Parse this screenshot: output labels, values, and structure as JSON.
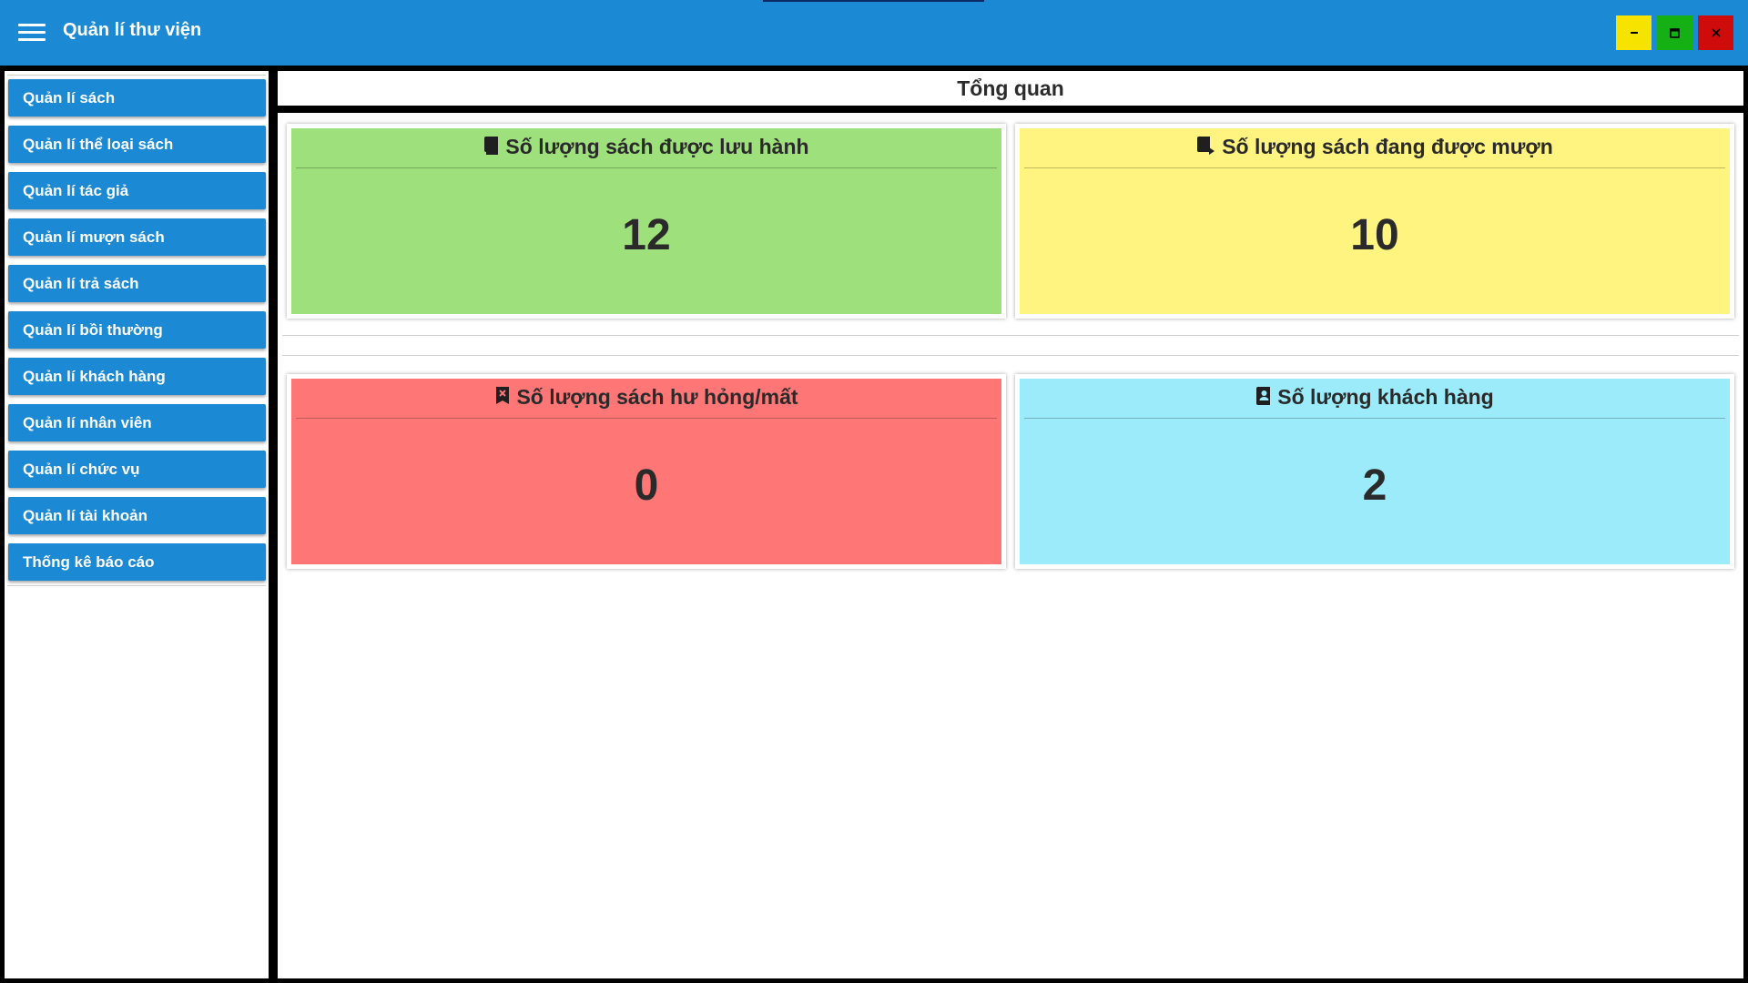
{
  "app": {
    "title": "Quản lí thư viện"
  },
  "window_controls": {
    "minimize": "minimize-icon",
    "maximize": "maximize-icon",
    "close": "close-icon"
  },
  "sidebar": {
    "items": [
      {
        "label": "Quản lí sách"
      },
      {
        "label": "Quản lí thể loại sách"
      },
      {
        "label": "Quản lí tác giả"
      },
      {
        "label": "Quản lí mượn sách"
      },
      {
        "label": "Quản lí trả sách"
      },
      {
        "label": "Quản lí bồi thường"
      },
      {
        "label": "Quản lí khách hàng"
      },
      {
        "label": "Quản lí nhân viên"
      },
      {
        "label": "Quản lí chức vụ"
      },
      {
        "label": "Quản lí tài khoản"
      },
      {
        "label": "Thống kê báo cáo"
      }
    ]
  },
  "main": {
    "header": "Tổng quan",
    "cards": [
      {
        "title": "Số lượng sách được lưu hành",
        "value": "12",
        "color": "#9ee07b",
        "icon": "book-icon"
      },
      {
        "title": "Số lượng sách đang được mượn",
        "value": "10",
        "color": "#fff47f",
        "icon": "book-borrow-icon"
      },
      {
        "title": "Số lượng sách hư hỏng/mất",
        "value": "0",
        "color": "#ff7676",
        "icon": "bookmark-remove-icon"
      },
      {
        "title": "Số lượng khách hàng",
        "value": "2",
        "color": "#9bebfb",
        "icon": "contact-book-icon"
      }
    ]
  },
  "colors": {
    "accent": "#1b89d3",
    "minimize": "#f7e300",
    "maximize": "#14b014",
    "close": "#cf0b0b"
  }
}
